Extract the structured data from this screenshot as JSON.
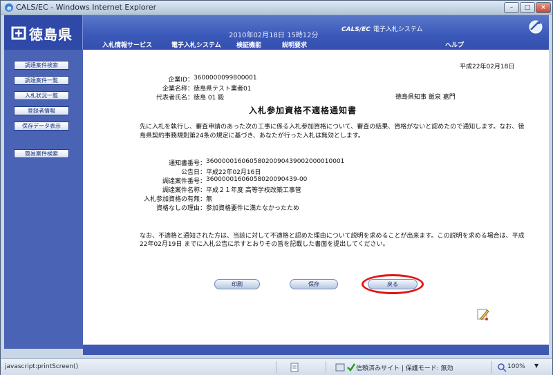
{
  "window": {
    "title": "CALS/EC - Windows Internet Explorer",
    "min": "–",
    "max": "□",
    "close": "×"
  },
  "header": {
    "prefecture": "徳島県",
    "datetime": "2010年02月18日 15時12分",
    "system_brand": "CALS/EC",
    "system_name": "電子入札システム",
    "menu": [
      "入札情報サービス",
      "電子入札システム",
      "検証機能",
      "説明要求",
      "ヘルプ"
    ]
  },
  "sidebar": {
    "items": [
      "調達案件検索",
      "調達案件一覧",
      "入札状況一覧",
      "登録者情報",
      "保存データ表示",
      "簡易案件検索"
    ]
  },
  "notice": {
    "date": "平成22年02月18日",
    "company_id_label": "企業ID：",
    "company_id": "3600000099800001",
    "company_name_label": "企業名称：",
    "company_name": "徳島県テスト業者01",
    "rep_label": "代表者氏名：",
    "rep_name": "徳島 01 殿",
    "governor": "徳島県知事 飯泉 嘉門",
    "title": "入札参加資格不適格通知書",
    "paragraph1": "先に入札を執行し、審査申請のあった次の工事に係る入札参加資格について、審査の結果、資格がないと認めたので通知します。なお、徳島県契約事務規則第24条の規定に基づき、あなたが行った入札は無効とします。",
    "fields": [
      {
        "label": "通知書番号：",
        "value": "36000001606058020090439002000010001"
      },
      {
        "label": "公告日：",
        "value": "平成22年02月16日"
      },
      {
        "label": "調達案件番号：",
        "value": "36000001606058020090439-00"
      },
      {
        "label": "調達案件名称：",
        "value": "平成２１年度 高等学校改築工事管"
      },
      {
        "label": "入札参加資格の有無：",
        "value": "無"
      },
      {
        "label": "資格なしの理由：",
        "value": "参加資格要件に満たなかったため"
      }
    ],
    "paragraph2": "なお、不適格と通知された方は、当該に対して不適格と認めた理由について説明を求めることが出来ます。この説明を求める場合は、平成22年02月19日 までに入札公告に示すとおりその旨を記載した書面を提出してください。"
  },
  "actions": {
    "print": "印刷",
    "save": "保存",
    "back": "戻る"
  },
  "statusbar": {
    "left": "javascript:printScreen()",
    "zone": "信頼済みサイト | 保護モード: 無効",
    "zoom": "100%"
  }
}
